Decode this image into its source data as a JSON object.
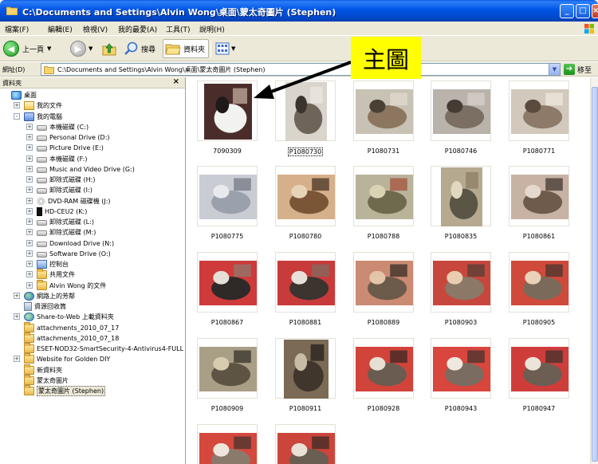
{
  "window": {
    "title": "C:\\Documents and Settings\\Alvin Wong\\桌面\\蒙太奇圖片 (Stephen)"
  },
  "menu": [
    "檔案(F)",
    "編輯(E)",
    "檢視(V)",
    "我的最愛(A)",
    "工具(T)",
    "說明(H)"
  ],
  "toolbar": {
    "back_label": "上一頁",
    "search_label": "搜尋",
    "folders_label": "資料夾"
  },
  "address": {
    "label": "網址(D)",
    "value": "C:\\Documents and Settings\\Alvin Wong\\桌面\\蒙太奇圖片 (Stephen)",
    "go_label": "移至"
  },
  "folders_pane": {
    "title": "資料夾",
    "close": "×",
    "tree": [
      {
        "label": "桌面",
        "icon": "desktop-icon"
      },
      {
        "label": "我的文件",
        "icon": "documents-icon"
      },
      {
        "label": "我的電腦",
        "icon": "computer-icon"
      },
      {
        "label": "本機磁碟 (C:)",
        "icon": "drive-icon"
      },
      {
        "label": "Personal Drive (D:)",
        "icon": "drive-icon"
      },
      {
        "label": "Picture Drive (E:)",
        "icon": "drive-icon"
      },
      {
        "label": "本機磁碟 (F:)",
        "icon": "drive-icon"
      },
      {
        "label": "Music and Video Drive (G:)",
        "icon": "drive-icon"
      },
      {
        "label": "卸除式磁碟 (H:)",
        "icon": "drive-icon"
      },
      {
        "label": "卸除式磁碟 (I:)",
        "icon": "drive-icon"
      },
      {
        "label": "DVD-RAM 磁碟機 (J:)",
        "icon": "dvd-icon"
      },
      {
        "label": "HD-CEU2 (K:)",
        "icon": "hd-icon"
      },
      {
        "label": "卸除式磁碟 (L:)",
        "icon": "drive-icon"
      },
      {
        "label": "卸除式磁碟 (M:)",
        "icon": "drive-icon"
      },
      {
        "label": "Download Drive (N:)",
        "icon": "drive-icon"
      },
      {
        "label": "Software Drive (O:)",
        "icon": "drive-icon"
      },
      {
        "label": "控制台",
        "icon": "control-panel-icon"
      },
      {
        "label": "共用文件",
        "icon": "folder-icon"
      },
      {
        "label": "Alvin Wong 的文件",
        "icon": "folder-icon"
      },
      {
        "label": "網路上的芳鄰",
        "icon": "network-icon"
      },
      {
        "label": "資源回收筒",
        "icon": "recycle-bin-icon"
      },
      {
        "label": "Share-to-Web 上載資料夾",
        "icon": "share-icon"
      },
      {
        "label": "attachments_2010_07_17",
        "icon": "folder-icon"
      },
      {
        "label": "attachments_2010_07_18",
        "icon": "folder-icon"
      },
      {
        "label": "ESET-NOD32-SmartSecurity-4-Antivirus4-FULL",
        "icon": "folder-icon"
      },
      {
        "label": "Website for Golden DIY",
        "icon": "folder-icon"
      },
      {
        "label": "新資料夾",
        "icon": "folder-icon"
      },
      {
        "label": "蒙太奇圖片",
        "icon": "folder-icon"
      },
      {
        "label": "蒙太奇圖片 (Stephen)",
        "icon": "folder-icon"
      }
    ]
  },
  "files": [
    {
      "name": "7090309"
    },
    {
      "name": "P1080730"
    },
    {
      "name": "P1080731"
    },
    {
      "name": "P1080746"
    },
    {
      "name": "P1080771"
    },
    {
      "name": "P1080775"
    },
    {
      "name": "P1080780"
    },
    {
      "name": "P1080788"
    },
    {
      "name": "P1080835"
    },
    {
      "name": "P1080861"
    },
    {
      "name": "P1080867"
    },
    {
      "name": "P1080881"
    },
    {
      "name": "P1080889"
    },
    {
      "name": "P1080903"
    },
    {
      "name": "P1080905"
    },
    {
      "name": "P1080909"
    },
    {
      "name": "P1080911"
    },
    {
      "name": "P1080928"
    },
    {
      "name": "P1080943"
    },
    {
      "name": "P1080947"
    },
    {
      "name": ""
    },
    {
      "name": ""
    }
  ],
  "annotation": {
    "text": "主圖",
    "color": "#ffff00"
  }
}
